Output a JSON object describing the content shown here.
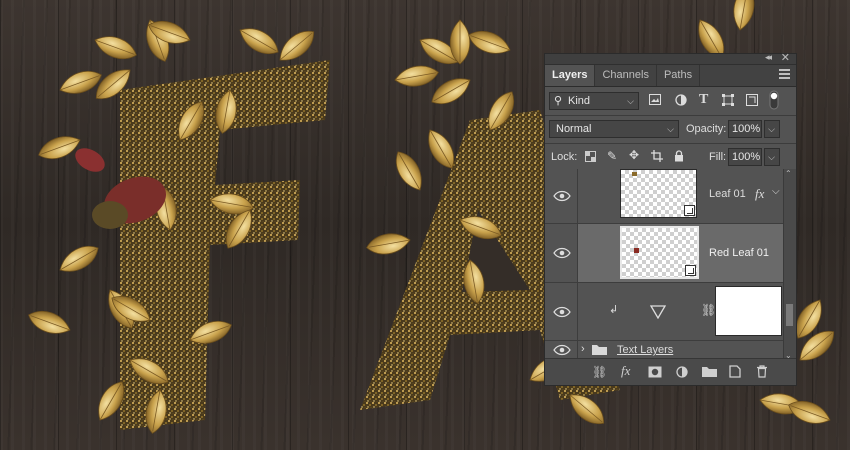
{
  "panel": {
    "tabs": [
      {
        "label": "Layers",
        "active": true
      },
      {
        "label": "Channels",
        "active": false
      },
      {
        "label": "Paths",
        "active": false
      }
    ],
    "filter": {
      "kind_label": "Kind"
    },
    "blend_mode": "Normal",
    "opacity_label": "Opacity:",
    "opacity_value": "100%",
    "lock_label": "Lock:",
    "fill_label": "Fill:",
    "fill_value": "100%",
    "layers": [
      {
        "name": "Leaf 01",
        "type": "smart-object",
        "visible": true,
        "selected": false,
        "effects": "fx"
      },
      {
        "name": "Red Leaf 01",
        "type": "smart-object",
        "visible": true,
        "selected": true
      },
      {
        "name": "",
        "type": "adjustment-with-mask",
        "visible": true,
        "selected": false
      },
      {
        "name": "Text Layers",
        "type": "group",
        "visible": true,
        "selected": false
      }
    ]
  },
  "icons": {
    "filter": "search-icon",
    "pixel_filter": "image-icon",
    "adjustment_filter": "half-circle-icon",
    "type_filter": "type-icon",
    "shape_filter": "shape-icon",
    "smart_filter": "smart-object-icon",
    "toggle_filter": "toggle-icon",
    "lock_pixels": "checker-lock-icon",
    "lock_brush": "brush-icon",
    "lock_move": "move-icon",
    "lock_artboard": "crop-icon",
    "lock_all": "lock-icon"
  },
  "colors": {
    "panel_bg": "#535353",
    "selected_row": "#6a6a6a",
    "wood": "#342d28",
    "gold": "#c9a44c"
  }
}
